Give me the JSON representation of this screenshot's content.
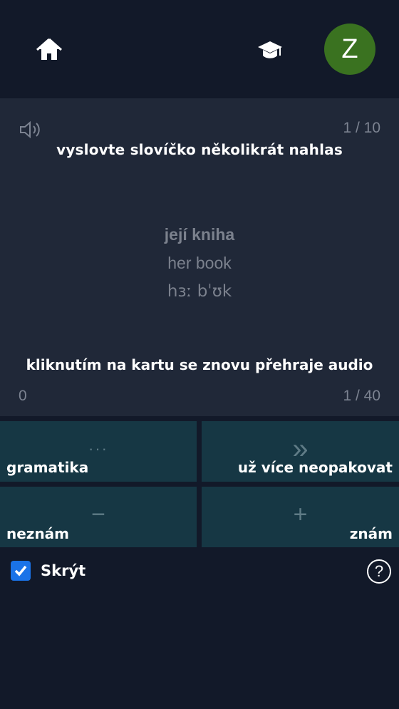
{
  "header": {
    "home_icon": "home-icon",
    "study_icon": "graduation-cap-icon",
    "avatar_letter": "Z",
    "avatar_color": "#3a7220"
  },
  "card": {
    "speaker_icon": "speaker-icon",
    "progress": "1 / 10",
    "instruction": "vyslovte slovíčko několikrát nahlas",
    "word": "její kniha",
    "translation": "her book",
    "ipa": "hɜː bˈʊk",
    "hint": "kliknutím na kartu se znovu přehraje audio",
    "left_count": "0",
    "right_count": "1 / 40"
  },
  "actions": [
    {
      "glyph": "···",
      "label": "gramatika"
    },
    {
      "glyph": "»",
      "label": "už více neopakovat"
    },
    {
      "glyph": "−",
      "label": "neznám"
    },
    {
      "glyph": "+",
      "label": "znám"
    }
  ],
  "footer": {
    "hide_label": "Skrýt",
    "hide_checked": true,
    "help_glyph": "?"
  },
  "colors": {
    "background": "#121929",
    "card": "#202838",
    "tile": "#163744",
    "checkbox": "#1a73e8"
  }
}
